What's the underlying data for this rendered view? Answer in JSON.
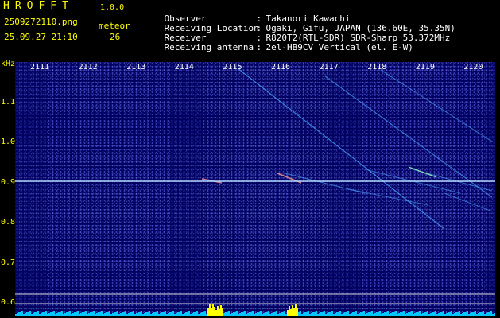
{
  "header": {
    "app_title": "HROFFT",
    "app_version": "1.0.0",
    "file_name": "2509272110.png",
    "date_time": "25.09.27 21:10",
    "meteor_label": "meteor",
    "meteor_count": "26"
  },
  "info": [
    {
      "key": "Observer",
      "value": "Takanori Kawachi"
    },
    {
      "key": "Receiving Location",
      "value": "Ogaki, Gifu, JAPAN (136.60E, 35.35N)"
    },
    {
      "key": "Receiver",
      "value": "R820T2(RTL-SDR) SDR-Sharp 53.372MHz"
    },
    {
      "key": "Receiving antenna",
      "value": "2el-HB9CV Vertical (el. E-W)"
    }
  ],
  "spectrogram": {
    "unit": "kHz",
    "x_ticks": [
      "2111",
      "2112",
      "2113",
      "2114",
      "2115",
      "2116",
      "2117",
      "2118",
      "2119",
      "2120"
    ],
    "y_ticks": [
      "1.1",
      "1.0",
      "0.9",
      "0.8",
      "0.7",
      "0.6"
    ],
    "colors": {
      "background": "#000060",
      "signal": "#4aa8ff",
      "carrier": "#b0d8ff",
      "activity": "#00c8ff",
      "activity_peak": "#ffff00"
    }
  }
}
